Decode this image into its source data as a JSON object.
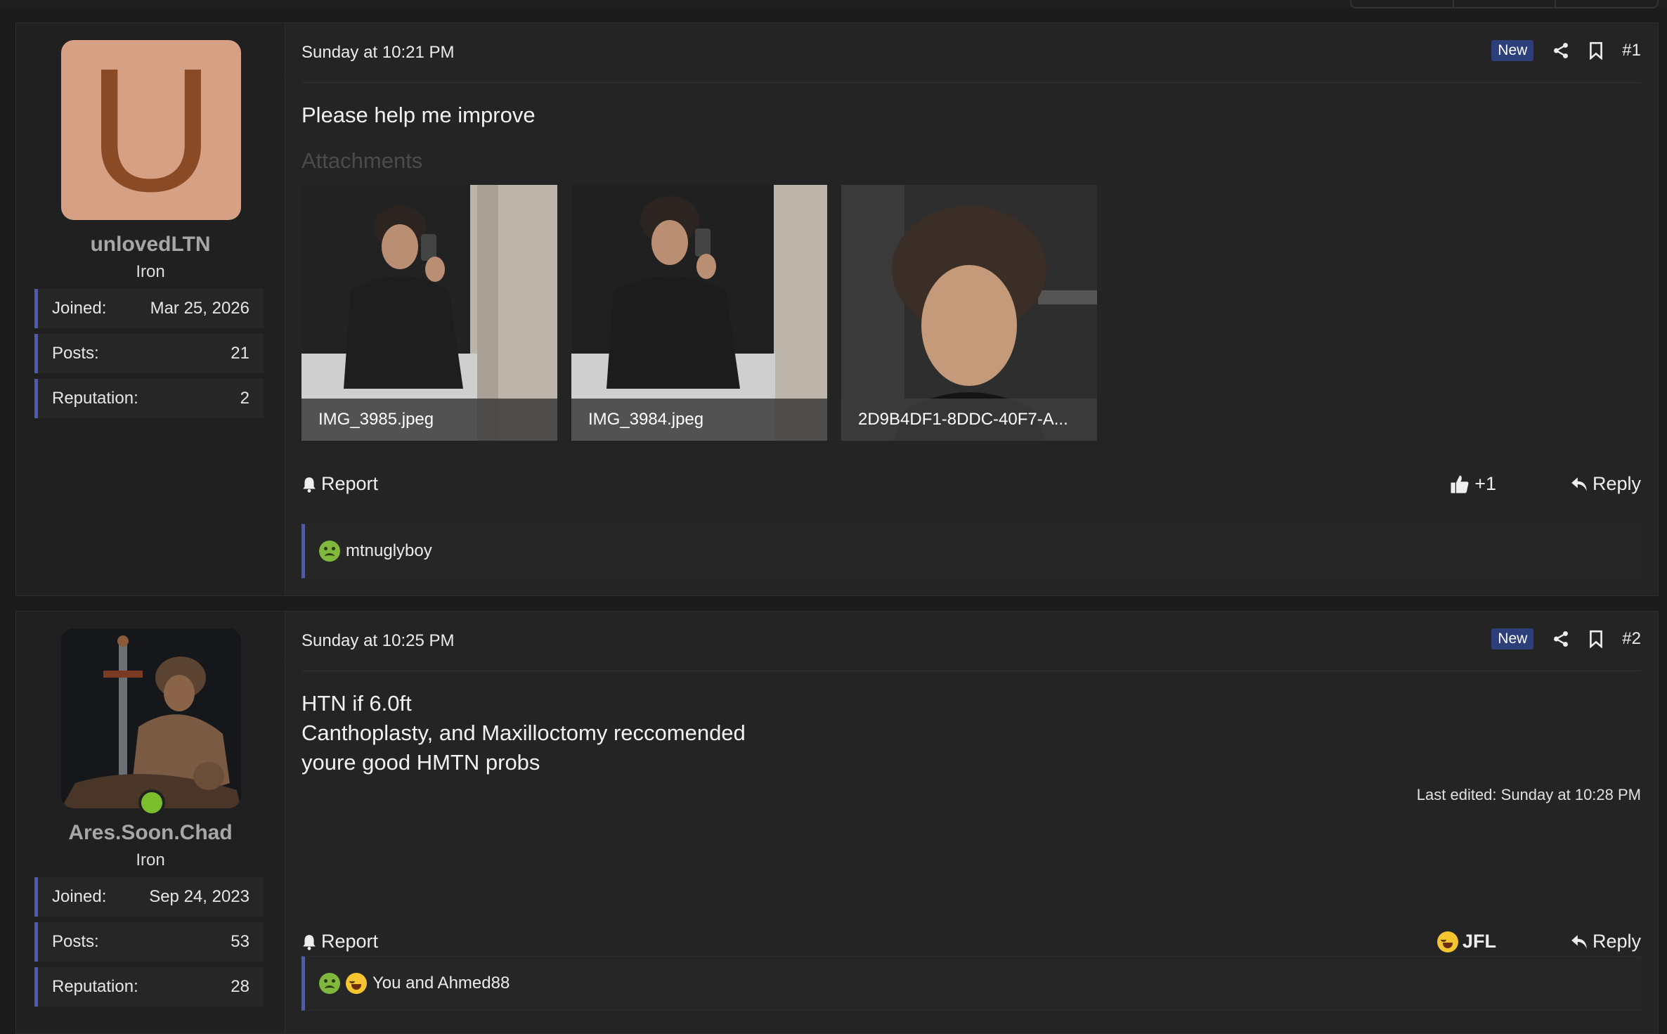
{
  "posts": [
    {
      "author": {
        "avatar_letter": "U",
        "username": "unlovedLTN",
        "rank": "Iron"
      },
      "stats": [
        {
          "label": "Joined:",
          "value": "Mar 25, 2026"
        },
        {
          "label": "Posts:",
          "value": "21"
        },
        {
          "label": "Reputation:",
          "value": "2"
        }
      ],
      "timestamp": "Sunday at 10:21 PM",
      "new_badge": "New",
      "post_number": "#1",
      "body": [
        "Please help me improve"
      ],
      "attachments_label": "Attachments",
      "attachments": [
        {
          "filename": "IMG_3985.jpeg"
        },
        {
          "filename": "IMG_3984.jpeg"
        },
        {
          "filename": "2D9B4DF1-8DDC-40F7-A..."
        }
      ],
      "report_label": "Report",
      "reaction_label": "+1",
      "reply_label": "Reply",
      "reactions_summary": "mtnuglyboy",
      "reaction_icon": "thumbs-up-icon"
    },
    {
      "author": {
        "username": "Ares.Soon.Chad",
        "rank": "Iron",
        "online": true
      },
      "stats": [
        {
          "label": "Joined:",
          "value": "Sep 24, 2023"
        },
        {
          "label": "Posts:",
          "value": "53"
        },
        {
          "label": "Reputation:",
          "value": "28"
        }
      ],
      "timestamp": "Sunday at 10:25 PM",
      "new_badge": "New",
      "post_number": "#2",
      "body": [
        "HTN if 6.0ft",
        "Canthoplasty, and Maxilloctomy reccomended",
        "youre good HMTN probs"
      ],
      "last_edited": "Last edited: Sunday at 10:28 PM",
      "report_label": "Report",
      "reaction_label": "JFL",
      "reply_label": "Reply",
      "reactions_summary": "You and Ahmed88",
      "reaction_icon": "laughing-emoji-icon"
    }
  ],
  "colors": {
    "background": "#1b1b1b",
    "panel": "#242424",
    "accent": "#4e5ab6",
    "new_badge": "#2c3f7a",
    "avatar_bg": "#d6a084",
    "online": "#7cbf2c"
  }
}
